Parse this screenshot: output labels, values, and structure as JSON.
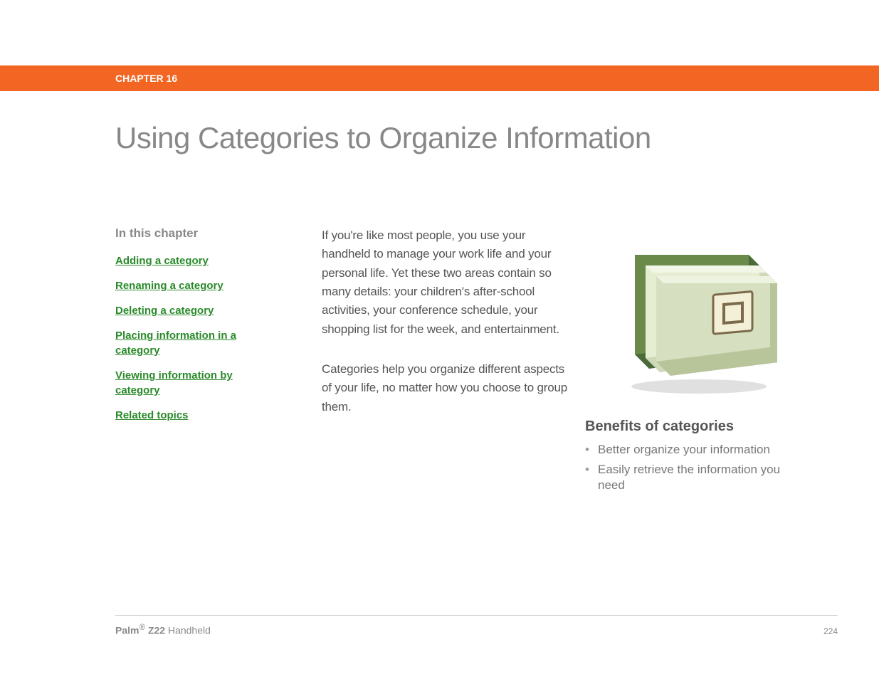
{
  "chapter_label": "CHAPTER 16",
  "page_title": "Using Categories to Organize Information",
  "toc": {
    "heading": "In this chapter",
    "items": [
      "Adding a category",
      "Renaming a category",
      "Deleting a category",
      "Placing information in a category",
      "Viewing information by category",
      "Related topics"
    ]
  },
  "body": {
    "para1": "If you're like most people, you use your handheld to manage your work life and your personal life. Yet these two areas contain so many details: your children's after-school activities, your conference schedule, your shopping list for the week, and entertainment.",
    "para2": "Categories help you organize different aspects of your life, no matter how you choose to group them."
  },
  "benefits": {
    "heading": "Benefits of categories",
    "items": [
      "Better organize your information",
      "Easily retrieve the information you need"
    ]
  },
  "footer": {
    "brand": "Palm",
    "reg": "®",
    "model": " Z22",
    "suffix": " Handheld",
    "page": "224"
  }
}
